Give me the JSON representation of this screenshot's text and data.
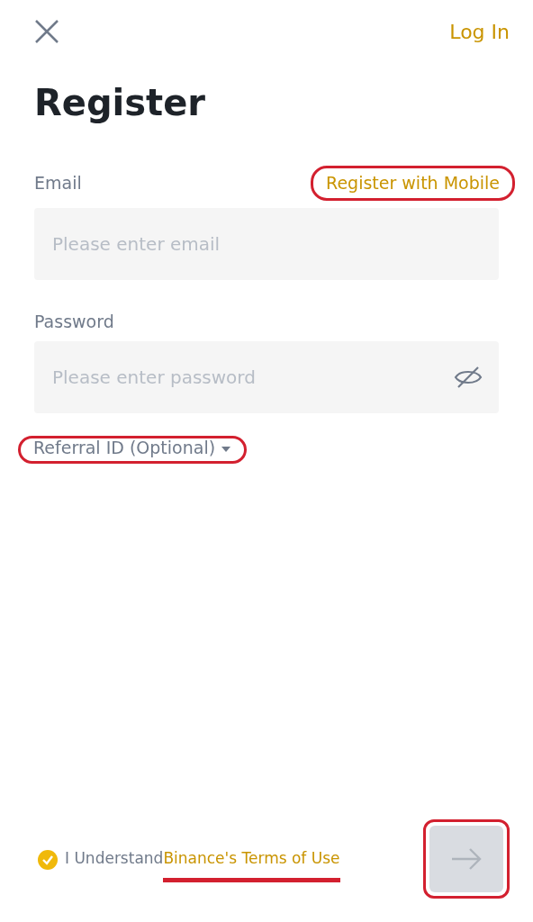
{
  "header": {
    "login": "Log In"
  },
  "title": "Register",
  "email": {
    "label": "Email",
    "switch_link": "Register with Mobile",
    "switch_highlighted": true,
    "placeholder": "Please enter email"
  },
  "password": {
    "label": "Password",
    "placeholder": "Please enter password"
  },
  "referral": {
    "label": "Referral ID (Optional)",
    "expanded": false,
    "highlighted": true
  },
  "terms": {
    "checked": true,
    "text": "I Understand",
    "link": "Binance's Terms of Use",
    "highlighted": true
  },
  "next_button": {
    "disabled": true,
    "highlighted": true
  }
}
